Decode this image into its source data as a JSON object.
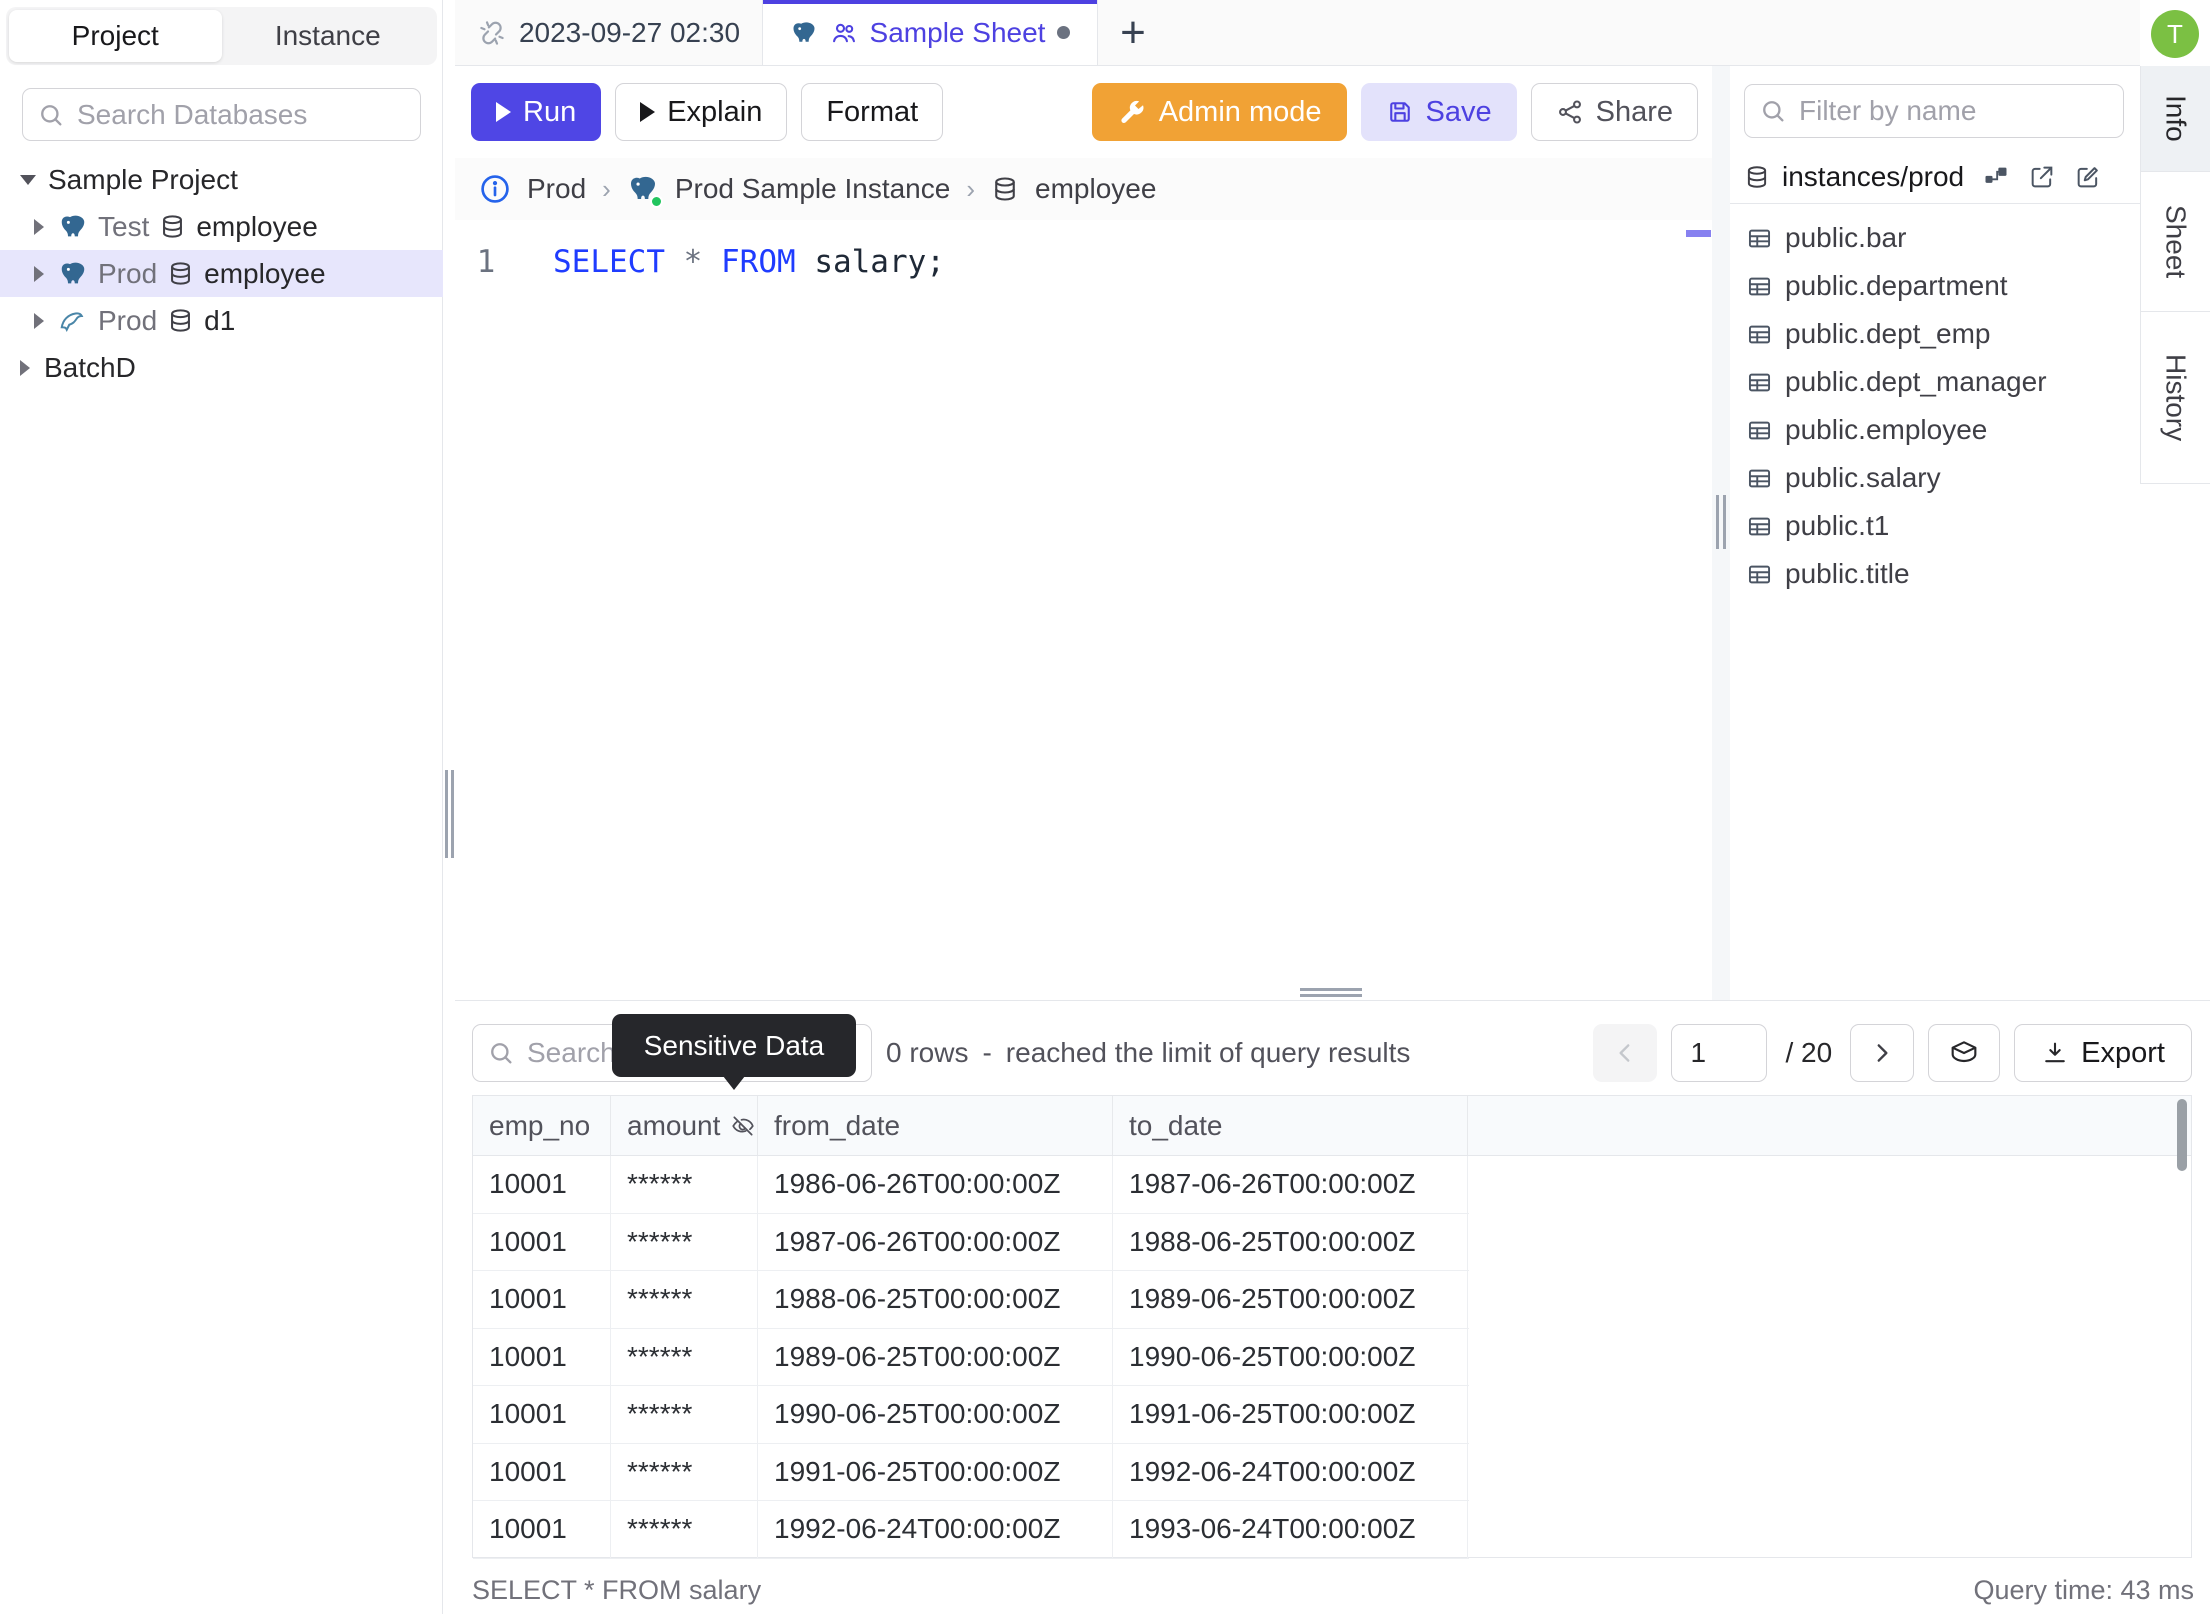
{
  "colors": {
    "accent": "#4d41e1",
    "admin_orange": "#f1a235",
    "avatar_green": "#7bc043",
    "keyword_blue": "#1f3cff",
    "status_green": "#22c55e"
  },
  "left_sidebar": {
    "tabs": {
      "project": "Project",
      "instance": "Instance"
    },
    "search_placeholder": "Search Databases",
    "tree": {
      "project1": "Sample Project",
      "items": [
        {
          "env": "Test",
          "db": "employee",
          "engine": "postgres"
        },
        {
          "env": "Prod",
          "db": "employee",
          "engine": "postgres",
          "selected": true
        },
        {
          "env": "Prod",
          "db": "d1",
          "engine": "mysql"
        }
      ],
      "project2": "BatchD"
    }
  },
  "tab_bar": {
    "tab_adhoc": "2023-09-27 02:30",
    "tab_sheet": "Sample Sheet",
    "new_tab": "+"
  },
  "toolbar": {
    "run": "Run",
    "explain": "Explain",
    "format": "Format",
    "admin_mode": "Admin mode",
    "save": "Save",
    "share": "Share"
  },
  "breadcrumb": {
    "environment": "Prod",
    "separator": "›",
    "instance": "Prod Sample Instance",
    "database": "employee"
  },
  "editor": {
    "line_number": "1",
    "kw_select": "SELECT",
    "star": "*",
    "kw_from": "FROM",
    "ident": " salary;"
  },
  "right_sidebar": {
    "filter_placeholder": "Filter by name",
    "header": "instances/prod",
    "tables": [
      "public.bar",
      "public.department",
      "public.dept_emp",
      "public.dept_manager",
      "public.employee",
      "public.salary",
      "public.t1",
      "public.title"
    ]
  },
  "right_rail": {
    "avatar": "T",
    "tab_info": "Info",
    "tab_sheet": "Sheet",
    "tab_history": "History"
  },
  "results": {
    "search_placeholder": "Search",
    "tooltip": "Sensitive Data",
    "row_count": "0 rows",
    "dash": "-",
    "limit_note": "reached the limit of query results",
    "page_value": "1",
    "page_total": "/ 20",
    "export": "Export",
    "columns": [
      "emp_no",
      "amount",
      "from_date",
      "to_date"
    ],
    "rows": [
      [
        "10001",
        "******",
        "1986-06-26T00:00:00Z",
        "1987-06-26T00:00:00Z"
      ],
      [
        "10001",
        "******",
        "1987-06-26T00:00:00Z",
        "1988-06-25T00:00:00Z"
      ],
      [
        "10001",
        "******",
        "1988-06-25T00:00:00Z",
        "1989-06-25T00:00:00Z"
      ],
      [
        "10001",
        "******",
        "1989-06-25T00:00:00Z",
        "1990-06-25T00:00:00Z"
      ],
      [
        "10001",
        "******",
        "1990-06-25T00:00:00Z",
        "1991-06-25T00:00:00Z"
      ],
      [
        "10001",
        "******",
        "1991-06-25T00:00:00Z",
        "1992-06-24T00:00:00Z"
      ],
      [
        "10001",
        "******",
        "1992-06-24T00:00:00Z",
        "1993-06-24T00:00:00Z"
      ]
    ],
    "status_query": "SELECT * FROM salary",
    "status_time": "Query time: 43 ms"
  }
}
